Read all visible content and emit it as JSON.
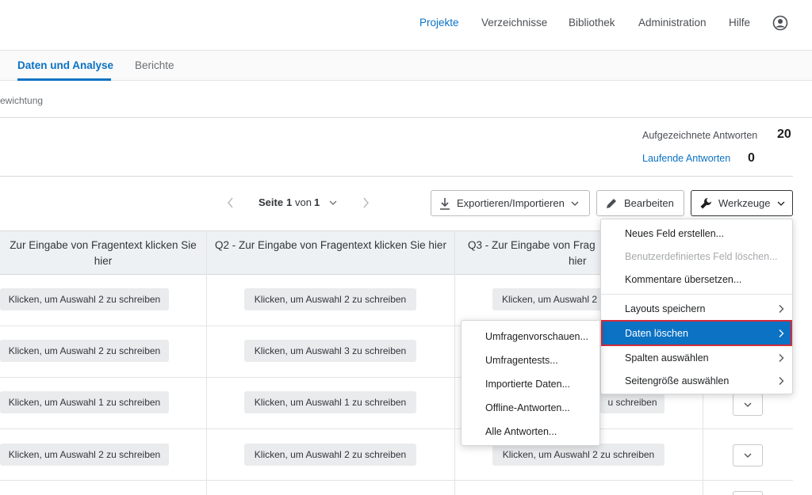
{
  "topnav": {
    "items": [
      "Projekte",
      "Verzeichnisse",
      "Bibliothek",
      "Administration",
      "Hilfe"
    ],
    "active": "Projekte",
    "account_icon": "user-circle-icon"
  },
  "subtabs": {
    "items": [
      "Daten und Analyse",
      "Berichte"
    ],
    "active": "Daten und Analyse"
  },
  "breadcrumb": {
    "text": "ewichtung"
  },
  "stats": {
    "recorded_label": "Aufgezeichnete Antworten",
    "recorded_value": "20",
    "running_label": "Laufende Antworten",
    "running_value": "0"
  },
  "pager": {
    "page_word": "Seite",
    "current": "1",
    "of_word": "von",
    "total": "1"
  },
  "toolbar": {
    "export_label": "Exportieren/Importieren",
    "edit_label": "Bearbeiten",
    "tools_label": "Werkzeuge"
  },
  "table": {
    "headers": [
      "Zur Eingabe von Fragentext klicken Sie hier",
      "Q2 - Zur Eingabe von Fragentext klicken Sie hier",
      "Q3 - Zur Eingabe von Frag",
      "hier"
    ],
    "rows": [
      [
        "Klicken, um Auswahl 2 zu schreiben",
        "Klicken, um Auswahl 2 zu schreiben",
        "Klicken, um Auswahl 2"
      ],
      [
        "Klicken, um Auswahl 2 zu schreiben",
        "Klicken, um Auswahl 3 zu schreiben"
      ],
      [
        "Klicken, um Auswahl 1 zu schreiben",
        "Klicken, um Auswahl 1 zu schreiben",
        "u schreiben"
      ],
      [
        "Klicken, um Auswahl 2 zu schreiben",
        "Klicken, um Auswahl 2 zu schreiben",
        "Klicken, um Auswahl 2 zu schreiben"
      ]
    ]
  },
  "tools_menu": {
    "items": [
      {
        "label": "Neues Feld erstellen...",
        "disabled": false
      },
      {
        "label": "Benutzerdefiniertes Feld löschen...",
        "disabled": true
      },
      {
        "label": "Kommentare übersetzen...",
        "disabled": false
      },
      {
        "label": "Layouts speichern",
        "submenu": true
      },
      {
        "label": "Daten löschen",
        "submenu": true,
        "highlighted": true
      },
      {
        "label": "Spalten auswählen",
        "submenu": true
      },
      {
        "label": "Seitengröße auswählen",
        "submenu": true
      }
    ]
  },
  "delete_submenu": {
    "items": [
      "Umfragenvorschauen...",
      "Umfragentests...",
      "Importierte Daten...",
      "Offline-Antworten...",
      "Alle Antworten..."
    ]
  },
  "colors": {
    "accent": "#0b72c4",
    "highlight_border": "#d52b3a"
  }
}
